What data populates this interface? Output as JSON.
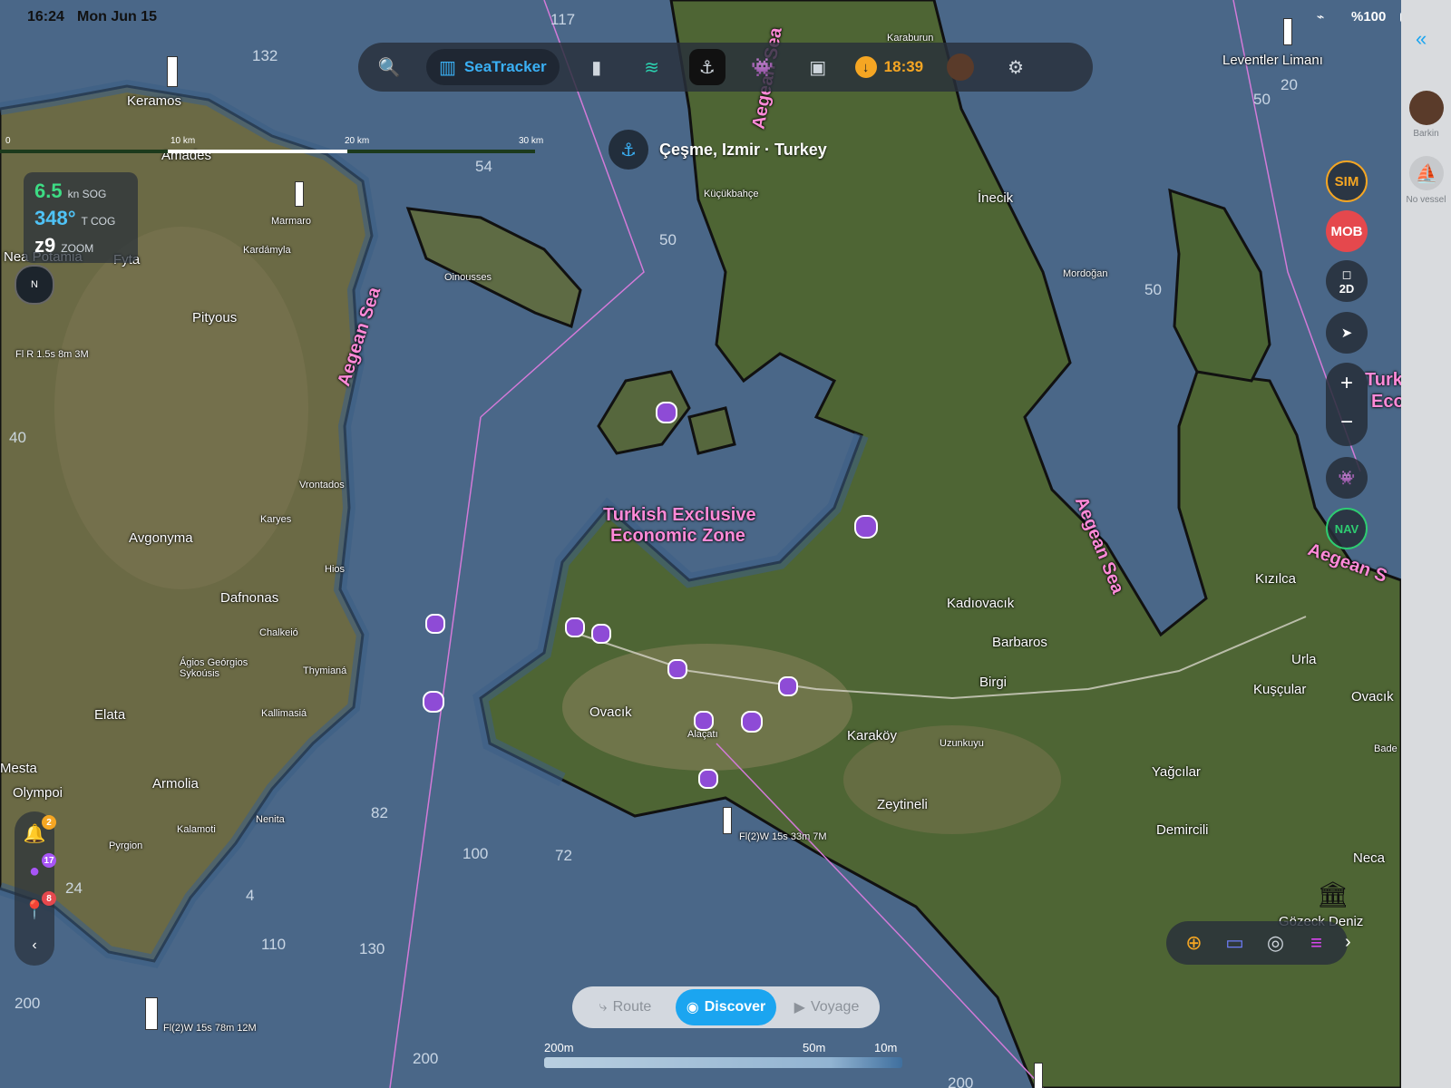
{
  "status": {
    "time": "16:24",
    "date": "Mon Jun 15",
    "battery": "%100"
  },
  "toolbar": {
    "brand_label": "SeaTracker",
    "eta_time": "18:39"
  },
  "location": {
    "label": "Çeşme, Izmir · Turkey"
  },
  "scale_bar": {
    "labels": [
      "0",
      "10 km",
      "20 km",
      "30 km"
    ]
  },
  "nav": {
    "sog_value": "6.5",
    "sog_unit": "kn SOG",
    "cog_value": "348°",
    "cog_unit": "T COG",
    "zoom_value": "z9",
    "zoom_unit": "ZOOM",
    "compass": "N"
  },
  "right_controls": {
    "sim": "SIM",
    "mob": "MOB",
    "view_mode": "2D",
    "zoom_in": "+",
    "zoom_out": "−",
    "nav": "NAV"
  },
  "sidebar": {
    "user_name": "Barkin",
    "vessel_label": "No vessel"
  },
  "left_tools": {
    "alerts_count": "2",
    "markers_count": "17",
    "pins_count": "8"
  },
  "bottom_segment": {
    "route": "Route",
    "discover": "Discover",
    "voyage": "Voyage",
    "active": "discover"
  },
  "depth_legend": {
    "labels": [
      "200m",
      "50m",
      "10m"
    ]
  },
  "colors": {
    "accent": "#1ba5f0",
    "sim": "#f5a623",
    "mob": "#e5484d",
    "nav": "#2ecc71",
    "sea_label": "#ff8ad8"
  },
  "map_labels": {
    "places": [
      "Leventler Limanı",
      "Karaburun",
      "Keramos",
      "Amades",
      "Marmaro",
      "Kardámyla",
      "Nea Potamia",
      "Fyta",
      "Pityous",
      "Oinousses",
      "Küçükbahçe",
      "İnecik",
      "Mordoğan",
      "Vrontados",
      "Karyes",
      "Hios",
      "Avgonyma",
      "Dafnonas",
      "Chalkeió",
      "Ágios Geórgios Sykoúsis",
      "Thymianá",
      "Kallimasiá",
      "Elata",
      "Mesta",
      "Olympoi",
      "Armolia",
      "Kalamoti",
      "Nenita",
      "Pyrgion",
      "Ovacık",
      "Alaçatı",
      "Kadıovacık",
      "Barbaros",
      "Birgi",
      "Karaköy",
      "Uzunkuyu",
      "Zeytineli",
      "Yağcılar",
      "Demircili",
      "Kızılca",
      "Urla",
      "Kuşçular",
      "Ovacık",
      "Neca",
      "Bade",
      "Gözeck Deniz"
    ],
    "seas": [
      "Aegean Sea",
      "Aegean Sea",
      "Aegean Sea",
      "Aegean S"
    ],
    "zone": [
      "Turkish Exclusive",
      "Economic Zone"
    ],
    "zone_edge": [
      "Turk",
      "Eco"
    ],
    "lights": [
      "Fl R 1.5s 8m 3M",
      "Fl(2)W 15s 33m 7M",
      "Fl(2)W 15s 78m 12M"
    ],
    "depths": [
      "117",
      "132",
      "54",
      "50",
      "40",
      "82",
      "100",
      "72",
      "110",
      "130",
      "200",
      "200",
      "200",
      "50",
      "20",
      "50",
      "24",
      "4"
    ]
  }
}
